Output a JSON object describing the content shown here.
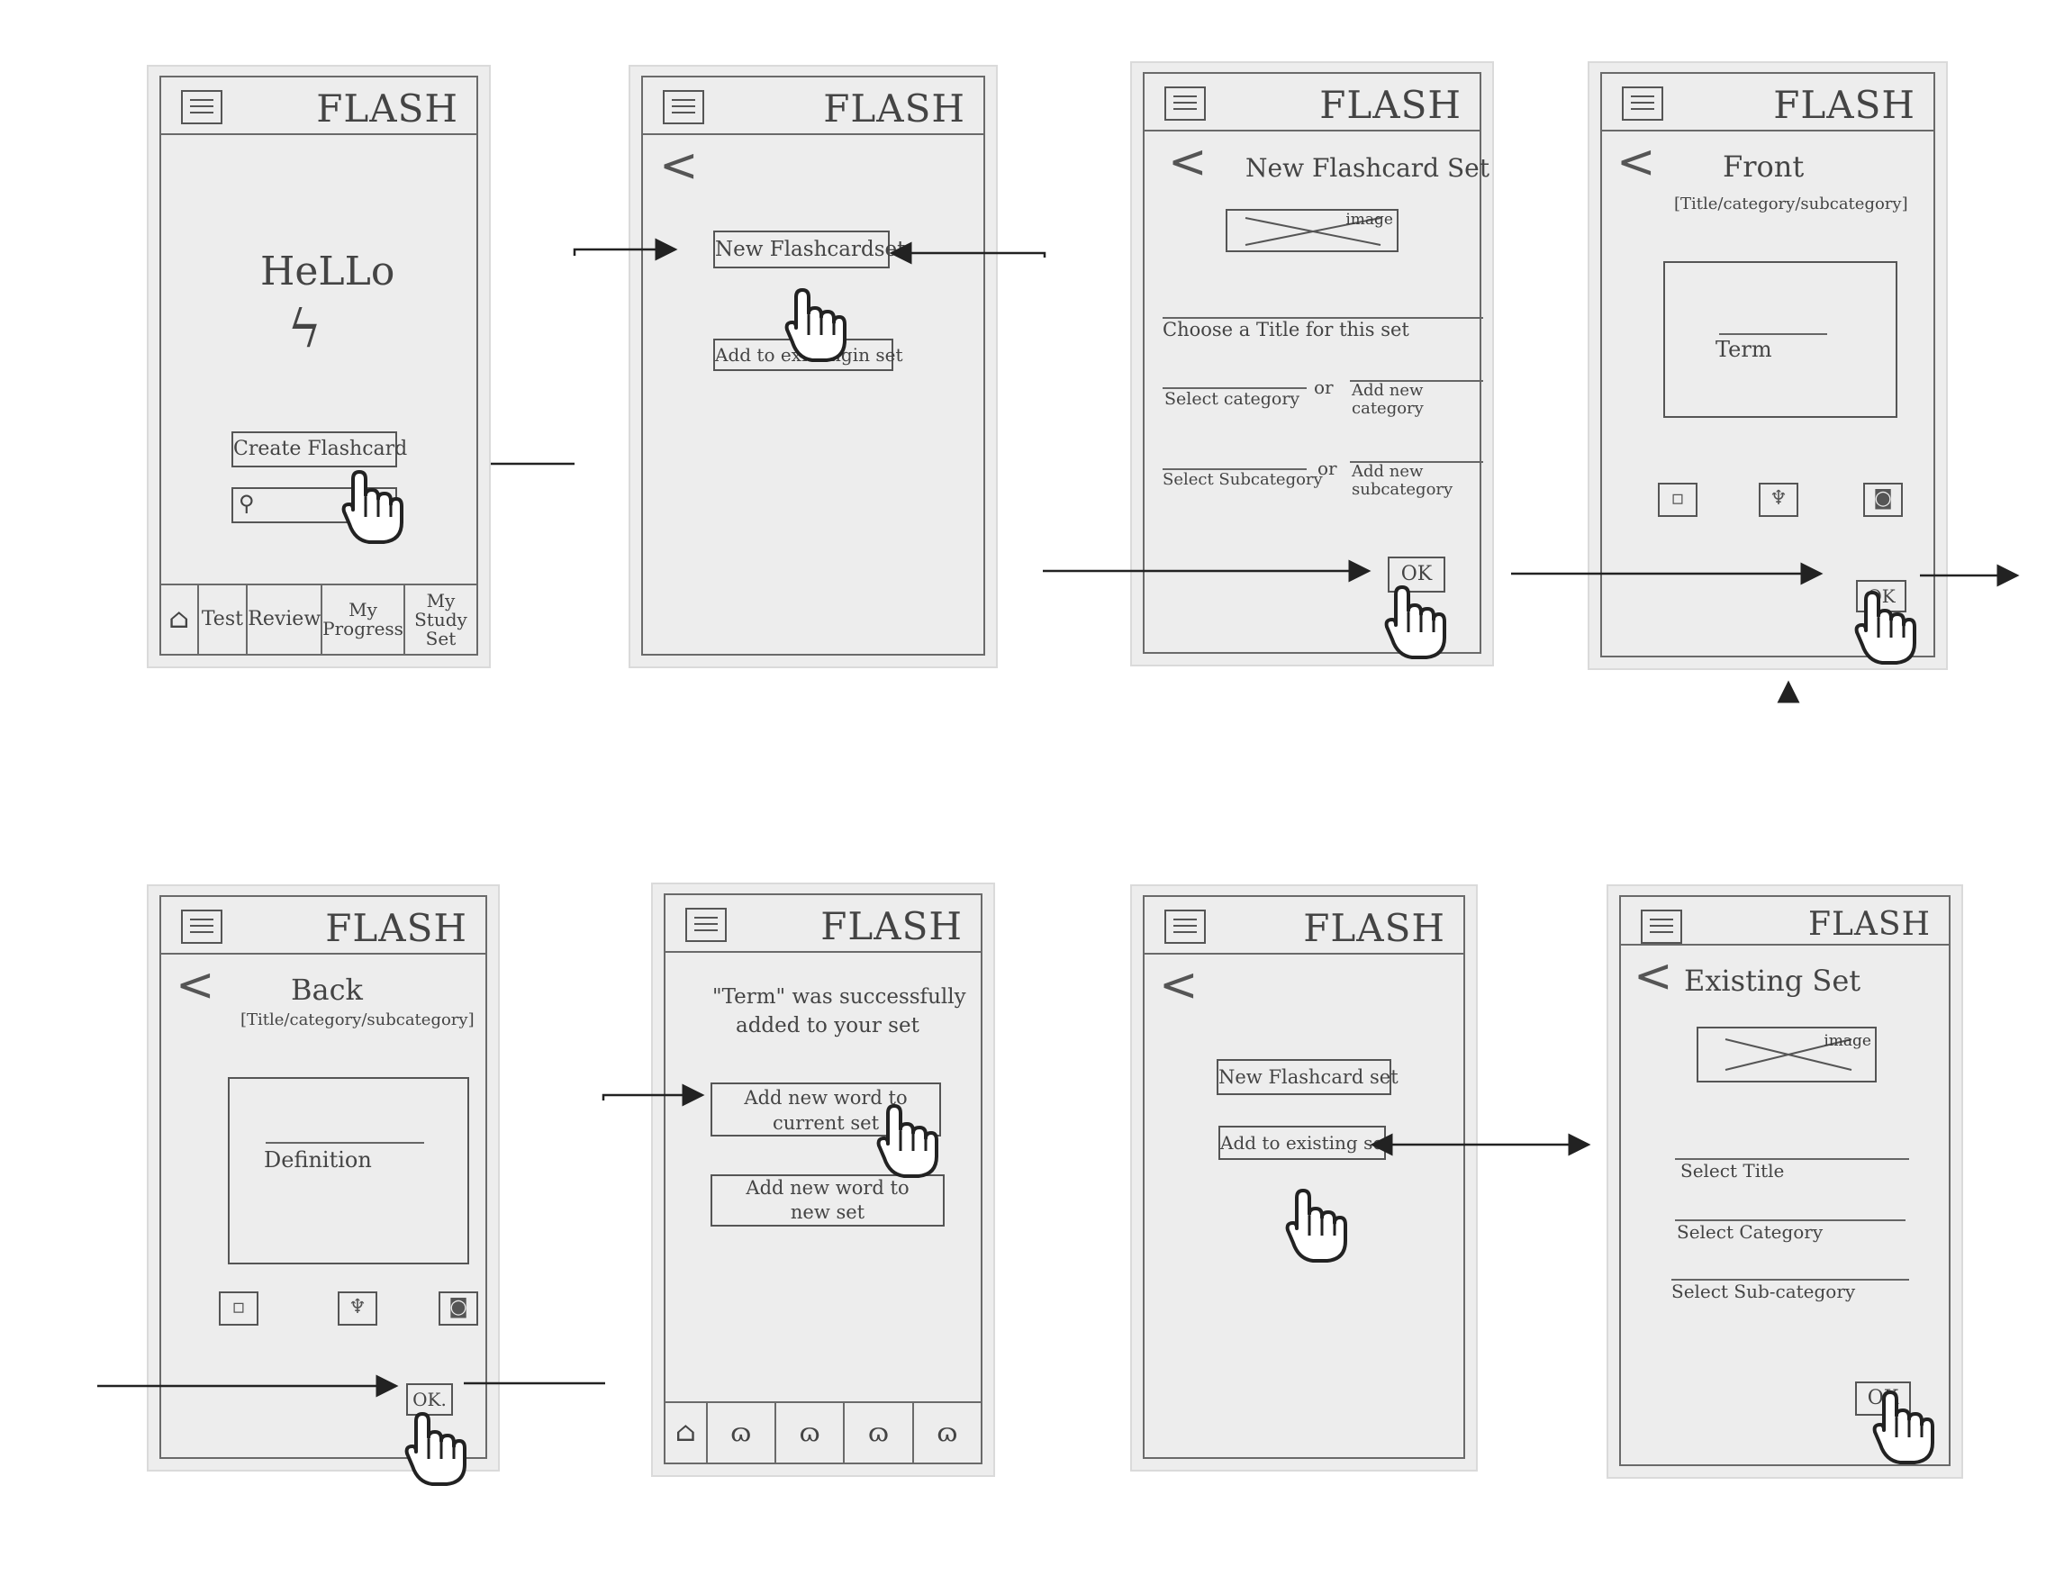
{
  "logo_text": "FLASH",
  "screen1": {
    "greeting": "HeLLo",
    "create_button": "Create Flashcard",
    "search_icon": "magnifier-icon",
    "nav": [
      "Test",
      "Review",
      "My Progress",
      "My Study Set"
    ]
  },
  "screen2": {
    "new_set_button": "New Flashcardset",
    "add_existing_button": "Add to existingin set"
  },
  "screen3": {
    "title": "New Flashcard Set",
    "image_label": "image",
    "title_field": "Choose a Title for this set",
    "select_category": "Select category",
    "or1": "or",
    "add_category": "Add new category",
    "select_subcategory": "Select Subcategory",
    "or2": "or",
    "add_subcategory": "Add new subcategory",
    "ok": "OK"
  },
  "screen4": {
    "title": "Front",
    "subtitle": "[Title/category/subcategory]",
    "term": "Term",
    "ok": "OK"
  },
  "screen5": {
    "title": "Back",
    "subtitle": "[Title/category/subcategory]",
    "definition": "Definition",
    "ok": "OK."
  },
  "screen6": {
    "message_line1": "\"Term\" was successfully",
    "message_line2": "added to your set",
    "add_current_line1": "Add new word to",
    "add_current_line2": "current set",
    "add_new_line1": "Add new word to",
    "add_new_line2": "new set"
  },
  "screen7": {
    "new_set_button": "New Flashcard set",
    "add_existing_button": "Add to existing set"
  },
  "screen8": {
    "title": "Existing Set",
    "image_label": "image",
    "select_title": "Select Title",
    "select_category": "Select Category",
    "select_subcategory": "Select Sub-category",
    "ok": "OK"
  }
}
